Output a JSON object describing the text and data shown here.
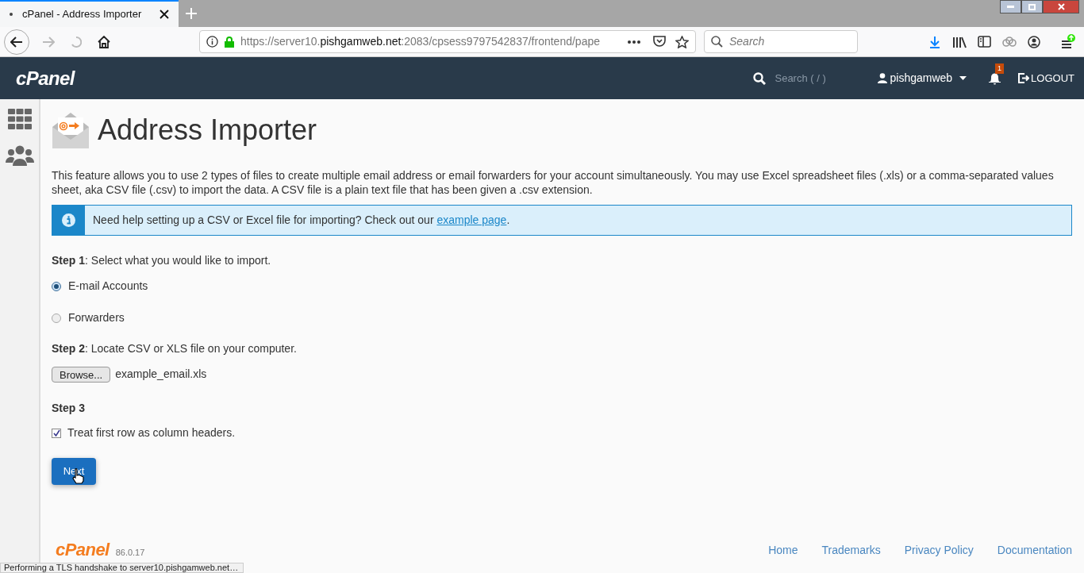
{
  "browser": {
    "tab_title": "cPanel - Address Importer",
    "url_prefix": "https://server10.",
    "url_host": "pishgamweb.net",
    "url_rest": ":2083/cpsess9797542837/frontend/pape",
    "search_placeholder": "Search"
  },
  "header": {
    "logo": "cPanel",
    "search_placeholder": "Search ( / )",
    "user": "pishgamweb",
    "notification_count": "1",
    "logout": "LOGOUT"
  },
  "page": {
    "title": "Address Importer",
    "description": "This feature allows you to use 2 types of files to create multiple email address or email forwarders for your account simultaneously. You may use Excel spreadsheet files (.xls) or a comma-separated values sheet, aka CSV file (.csv) to import the data. A CSV file is a plain text file that has been given a .csv extension.",
    "info": {
      "text": "Need help setting up a CSV or Excel file for importing? Check out our ",
      "link": "example page",
      "after": "."
    },
    "step1": {
      "label": "**Step 1**: Select what you would like to import.",
      "options": [
        {
          "label": "E-mail Accounts",
          "selected": true
        },
        {
          "label": "Forwarders",
          "selected": false
        }
      ]
    },
    "step2": {
      "label": "**Step 2**: Locate CSV or XLS file on your computer.",
      "browse_button": "Browse...",
      "file_name": "example_email.xls"
    },
    "step3": {
      "label": "Step 3",
      "checkbox": {
        "label": "Treat first row as column headers.",
        "checked": true
      }
    },
    "next_button": "Next"
  },
  "footer": {
    "logo": "cPanel",
    "version": "86.0.17",
    "links": [
      "Home",
      "Trademarks",
      "Privacy Policy",
      "Documentation"
    ]
  },
  "status_bar": "Performing a TLS handshake to server10.pishgamweb.net…"
}
